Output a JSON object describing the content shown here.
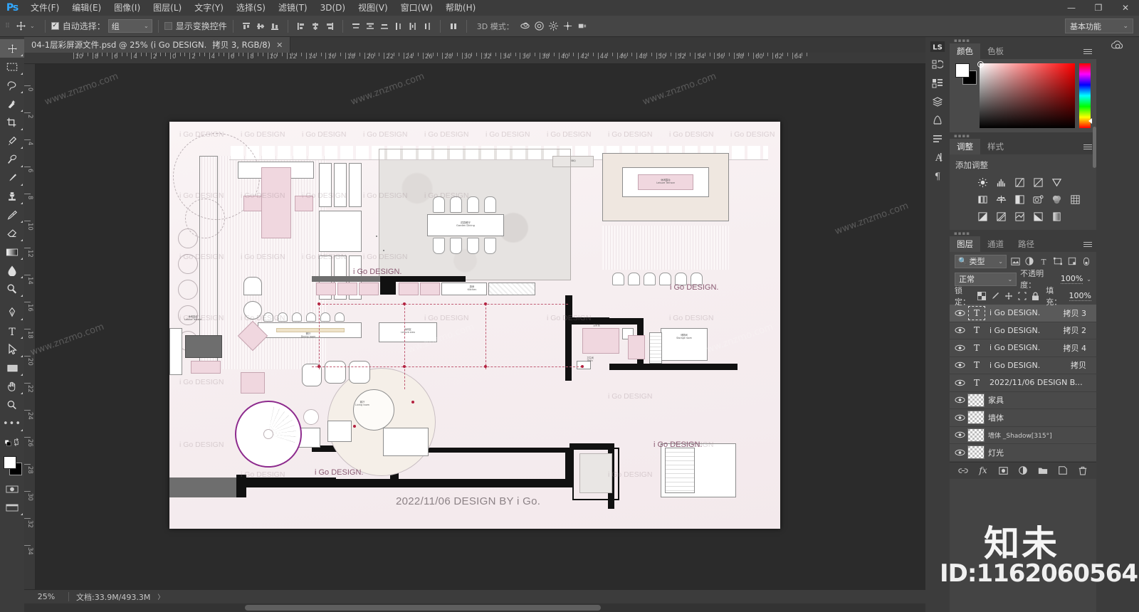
{
  "app": {
    "name": "Photoshop",
    "logo_text": "Ps",
    "workspace": "基本功能",
    "workspace_caret": "⌄"
  },
  "window_controls": {
    "minimize": "—",
    "maximize": "❐",
    "close": "✕"
  },
  "menubar": {
    "items": [
      {
        "label": "文件(F)"
      },
      {
        "label": "编辑(E)"
      },
      {
        "label": "图像(I)"
      },
      {
        "label": "图层(L)"
      },
      {
        "label": "文字(Y)"
      },
      {
        "label": "选择(S)"
      },
      {
        "label": "滤镜(T)"
      },
      {
        "label": "3D(D)"
      },
      {
        "label": "视图(V)"
      },
      {
        "label": "窗口(W)"
      },
      {
        "label": "帮助(H)"
      }
    ]
  },
  "options_bar": {
    "tool_icon": "move-tool",
    "auto_select_label": "自动选择：",
    "auto_select_checked": true,
    "auto_select_value": "组",
    "show_transform_label": "显示变换控件",
    "show_transform_checked": false,
    "mode_3d_label": "3D 模式：",
    "align_icons": [
      "align-top-edges",
      "align-vertical-centers",
      "align-bottom-edges",
      "align-left-edges",
      "align-horizontal-centers",
      "align-right-edges"
    ],
    "distribute_icons": [
      "distribute-top-edges",
      "distribute-vertical-centers",
      "distribute-bottom-edges",
      "distribute-left-edges",
      "distribute-horizontal-centers",
      "distribute-right-edges"
    ],
    "extra_icon": "distribute-spacing",
    "icons_3d": [
      "3d-orbit",
      "3d-roll",
      "3d-pan",
      "3d-slide",
      "3d-scale"
    ]
  },
  "document_tab": {
    "title": "04-1层彩屏源文件.psd @ 25% (i Go DESIGN.",
    "layer_suffix": "拷贝 3, RGB/8)",
    "close": "✕"
  },
  "toolbar": {
    "tools": [
      {
        "name": "move-tool",
        "glyph": "✥",
        "active": true
      },
      {
        "name": "rectangular-marquee-tool",
        "glyph": "▭"
      },
      {
        "name": "lasso-tool",
        "glyph": "𐤀"
      },
      {
        "name": "quick-selection-tool",
        "glyph": "✨"
      },
      {
        "name": "crop-tool",
        "glyph": "⌗"
      },
      {
        "name": "eyedropper-tool",
        "glyph": "⌇"
      },
      {
        "name": "spot-healing-brush-tool",
        "glyph": "✐"
      },
      {
        "name": "brush-tool",
        "glyph": "🖌"
      },
      {
        "name": "clone-stamp-tool",
        "glyph": "⎙"
      },
      {
        "name": "history-brush-tool",
        "glyph": "✎"
      },
      {
        "name": "eraser-tool",
        "glyph": "⌫"
      },
      {
        "name": "gradient-tool",
        "glyph": "▤"
      },
      {
        "name": "blur-tool",
        "glyph": "💧"
      },
      {
        "name": "dodge-tool",
        "glyph": "◕"
      },
      {
        "name": "pen-tool",
        "glyph": "✒"
      },
      {
        "name": "horizontal-type-tool",
        "glyph": "T"
      },
      {
        "name": "path-selection-tool",
        "glyph": "➤"
      },
      {
        "name": "rectangle-tool",
        "glyph": "▢"
      },
      {
        "name": "hand-tool",
        "glyph": "✋"
      },
      {
        "name": "zoom-tool",
        "glyph": "🔍"
      },
      {
        "name": "edit-toolbar-more",
        "glyph": "⋯"
      }
    ],
    "foreground_color": "#ffffff",
    "background_color": "#000000",
    "quick-mask": "▣",
    "screen-mode": "▥"
  },
  "rulers": {
    "unit_hint": "cm",
    "top_ticks": [
      10,
      8,
      6,
      4,
      2,
      0,
      2,
      4,
      6,
      8,
      10,
      12,
      14,
      16,
      18,
      20,
      22,
      24,
      26,
      28,
      30,
      32,
      34,
      36,
      38,
      40,
      42,
      44,
      46,
      48,
      50,
      52,
      54,
      56,
      58,
      60,
      62,
      64
    ],
    "left_ticks": [
      4,
      2,
      0,
      2,
      4,
      6,
      8,
      10,
      12,
      14,
      16,
      18,
      20,
      22,
      24,
      26,
      28,
      30,
      32,
      34
    ]
  },
  "canvas": {
    "plan_title_date": "2022/11/06 DESIGN BY i Go.",
    "brand_marks": [
      "i Go DESIGN.",
      "i Go DESIGN.",
      "i Go DESIGN.",
      "i Go DESIGN.",
      "i Go DESIGN."
    ],
    "watermark_text": "i Go DESIGN",
    "room_labels": [
      {
        "cn": "花园餐厅",
        "en": "Garden Dining"
      },
      {
        "cn": "休闲露台",
        "en": "Leisure Terrace"
      },
      {
        "cn": "餐厅",
        "en": "Dining room"
      },
      {
        "cn": "客厅",
        "en": "Living room"
      },
      {
        "cn": "主卧室",
        "en": "Master bedroom"
      },
      {
        "cn": "厨房",
        "en": "Kitchen"
      },
      {
        "cn": "卫生间",
        "en": "Bath"
      },
      {
        "cn": "储物间",
        "en": "Storage room"
      },
      {
        "cn": "休闲露台",
        "en": "Leisure Terrace"
      }
    ]
  },
  "status_bar": {
    "zoom": "25%",
    "doc_info": "文档:33.9M/493.3M",
    "expand_arrow": "〉"
  },
  "dock_strip": {
    "icons": [
      {
        "name": "library-icon",
        "glyph": "LS"
      },
      {
        "name": "history-icon",
        "glyph": "⟲"
      },
      {
        "name": "actions-icon",
        "glyph": "▶"
      },
      {
        "name": "layer-comps-icon",
        "glyph": "◳"
      },
      {
        "name": "brush-settings-icon",
        "glyph": "✦"
      },
      {
        "name": "properties-icon",
        "glyph": "☰"
      },
      {
        "name": "character-icon",
        "glyph": "A"
      },
      {
        "name": "paragraph-icon",
        "glyph": "¶"
      }
    ],
    "right_icon": {
      "name": "creative-cloud-icon",
      "glyph": "◎"
    }
  },
  "color_panel": {
    "tabs": [
      {
        "label": "颜色",
        "selected": true
      },
      {
        "label": "色板",
        "selected": false
      }
    ],
    "menu_icon": "panel-menu-icon",
    "foreground": "#ffffff",
    "background": "#000000",
    "spectrum_hue": "#ff0000"
  },
  "adjustments_panel": {
    "tabs": [
      {
        "label": "调整",
        "selected": true
      },
      {
        "label": "样式",
        "selected": false
      }
    ],
    "title": "添加调整",
    "row1": [
      {
        "name": "brightness-contrast-icon",
        "glyph": "☀"
      },
      {
        "name": "levels-icon",
        "glyph": "▥"
      },
      {
        "name": "curves-icon",
        "glyph": "◲"
      },
      {
        "name": "exposure-icon",
        "glyph": "◪"
      },
      {
        "name": "vibrance-icon",
        "glyph": "▽"
      }
    ],
    "row2": [
      {
        "name": "hue-saturation-icon",
        "glyph": "▦"
      },
      {
        "name": "color-balance-icon",
        "glyph": "⚖"
      },
      {
        "name": "black-white-icon",
        "glyph": "◑"
      },
      {
        "name": "photo-filter-icon",
        "glyph": "◔"
      },
      {
        "name": "channel-mixer-icon",
        "glyph": "◉"
      },
      {
        "name": "color-lookup-icon",
        "glyph": "▦"
      }
    ],
    "row3": [
      {
        "name": "invert-icon",
        "glyph": "◨"
      },
      {
        "name": "posterize-icon",
        "glyph": "◩"
      },
      {
        "name": "threshold-icon",
        "glyph": "◪"
      },
      {
        "name": "gradient-map-icon",
        "glyph": "◣"
      },
      {
        "name": "selective-color-icon",
        "glyph": "▯"
      }
    ]
  },
  "layers_panel": {
    "tabs": [
      {
        "label": "图层",
        "selected": true
      },
      {
        "label": "通道",
        "selected": false
      },
      {
        "label": "路径",
        "selected": false
      }
    ],
    "filter": {
      "search_icon": "search-icon",
      "kind_label": "类型",
      "caret": "⌄",
      "icons": [
        {
          "name": "filter-pixel-icon",
          "glyph": "▣"
        },
        {
          "name": "filter-adjustment-icon",
          "glyph": "◐"
        },
        {
          "name": "filter-type-icon",
          "glyph": "T"
        },
        {
          "name": "filter-shape-icon",
          "glyph": "❏"
        },
        {
          "name": "filter-smart-object-icon",
          "glyph": "▤"
        }
      ],
      "toggle": "filter-enable-toggle"
    },
    "blend_mode": "正常",
    "opacity_label": "不透明度：",
    "opacity_value": "100%",
    "lock_label": "锁定：",
    "lock_icons": [
      {
        "name": "lock-transparent-pixels-icon",
        "glyph": "▨"
      },
      {
        "name": "lock-image-pixels-icon",
        "glyph": "🖌"
      },
      {
        "name": "lock-position-icon",
        "glyph": "✥"
      },
      {
        "name": "lock-artboard-nesting-icon",
        "glyph": "⛶"
      },
      {
        "name": "lock-all-icon",
        "glyph": "🔒"
      }
    ],
    "fill_label": "填充：",
    "fill_value": "100%",
    "layers": [
      {
        "name": "i Go DESIGN.",
        "copy": "拷贝 3",
        "type": "text",
        "visible": true,
        "selected": true
      },
      {
        "name": "i Go DESIGN.",
        "copy": "拷贝 2",
        "type": "text",
        "visible": true,
        "selected": false
      },
      {
        "name": "i Go DESIGN.",
        "copy": "拷贝 4",
        "type": "text",
        "visible": true,
        "selected": false
      },
      {
        "name": "i Go DESIGN.",
        "copy": "拷贝",
        "type": "text",
        "visible": true,
        "selected": false
      },
      {
        "name": "2022/11/06 DESIGN BY i ...",
        "copy": "",
        "type": "text",
        "visible": true,
        "selected": false
      },
      {
        "name": "家具",
        "copy": "",
        "type": "image",
        "visible": true,
        "selected": false
      },
      {
        "name": "墙体",
        "copy": "",
        "type": "image",
        "visible": true,
        "selected": false
      },
      {
        "name": "墙体 _Shadow[315°]",
        "copy": "",
        "type": "image",
        "visible": true,
        "selected": false
      },
      {
        "name": "灯光",
        "copy": "",
        "type": "image",
        "visible": true,
        "selected": false
      }
    ],
    "footer_icons": [
      {
        "name": "link-layers-icon",
        "glyph": "⛓"
      },
      {
        "name": "layer-style-icon",
        "glyph": "fx"
      },
      {
        "name": "layer-mask-icon",
        "glyph": "▣"
      },
      {
        "name": "new-fill-adjustment-icon",
        "glyph": "◑"
      },
      {
        "name": "new-group-icon",
        "glyph": "🗀"
      },
      {
        "name": "new-layer-icon",
        "glyph": "⊞"
      },
      {
        "name": "delete-layer-icon",
        "glyph": "🗑"
      }
    ]
  },
  "overlay_watermarks": {
    "id_text": "ID:1162060564",
    "brand_cn": "知未",
    "site": "www.znzmo.com",
    "site_cn": "知末网 www.znzmo.com"
  }
}
